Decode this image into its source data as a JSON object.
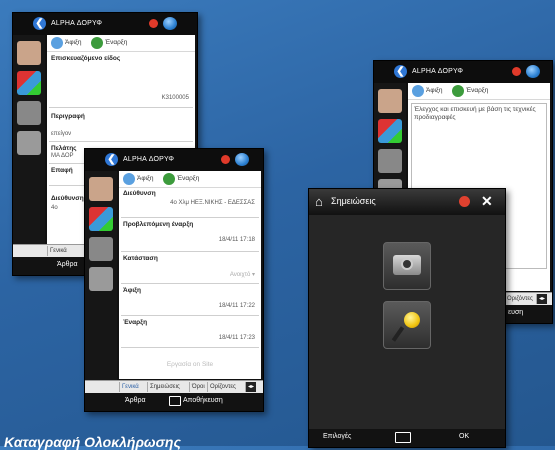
{
  "caption": "Καταγραφή Ολοκλήρωσης",
  "status_title": "ALPHA ΔΟΡΥΦ",
  "tabs": {
    "arrival": "Άφιξη",
    "start": "Έναρξη"
  },
  "screen1": {
    "field1_label": "Επισκευαζόμενο είδος",
    "field1_value": "K3100005",
    "field2_label": "Περιγραφή",
    "field2_value": "επείγον",
    "field3_label": "Πελάτης",
    "field3_value": "ΜΑ ΔΟΡ",
    "field4_label": "Επαφή",
    "field5_label": "Διεύθυνση",
    "field5_value": "4ο",
    "bottom_tab": "Γενικά",
    "bottom_left": "Άρθρα"
  },
  "screen2": {
    "address_label": "Διεύθυνση",
    "address_value": "4ο Χλμ ΗΕΞ.ΝΙΚΗΣ - ΕΔΕΣΣΑΣ",
    "planned_label": "Προβλεπόμενη έναρξη",
    "planned_value": "18/4/11 17:18",
    "status_label": "Κατάσταση",
    "status_value": "Ανοιχτό ▾",
    "arrival_label": "Άφιξη",
    "arrival_value": "18/4/11 17:22",
    "start_label": "Έναρξη",
    "start_value": "18/4/11 17:23",
    "onsite": "Εργασία on Site",
    "bottom_tabs": [
      "Γενικά",
      "Σημειώσεις",
      "Όροι",
      "Ορίζοντες"
    ],
    "bottom_left": "Άρθρα",
    "bottom_right": "Αποθήκευση"
  },
  "screen3": {
    "note_text": "Έλεγχος και επισκευή με βάση τις τεχνικές προδιαγραφές",
    "bottom_tab": "Οριζόντες",
    "bottom_right": "ευση"
  },
  "screen4": {
    "title": "Σημειώσεις",
    "left_soft": "Επιλογές",
    "right_soft": "ΟΚ"
  }
}
